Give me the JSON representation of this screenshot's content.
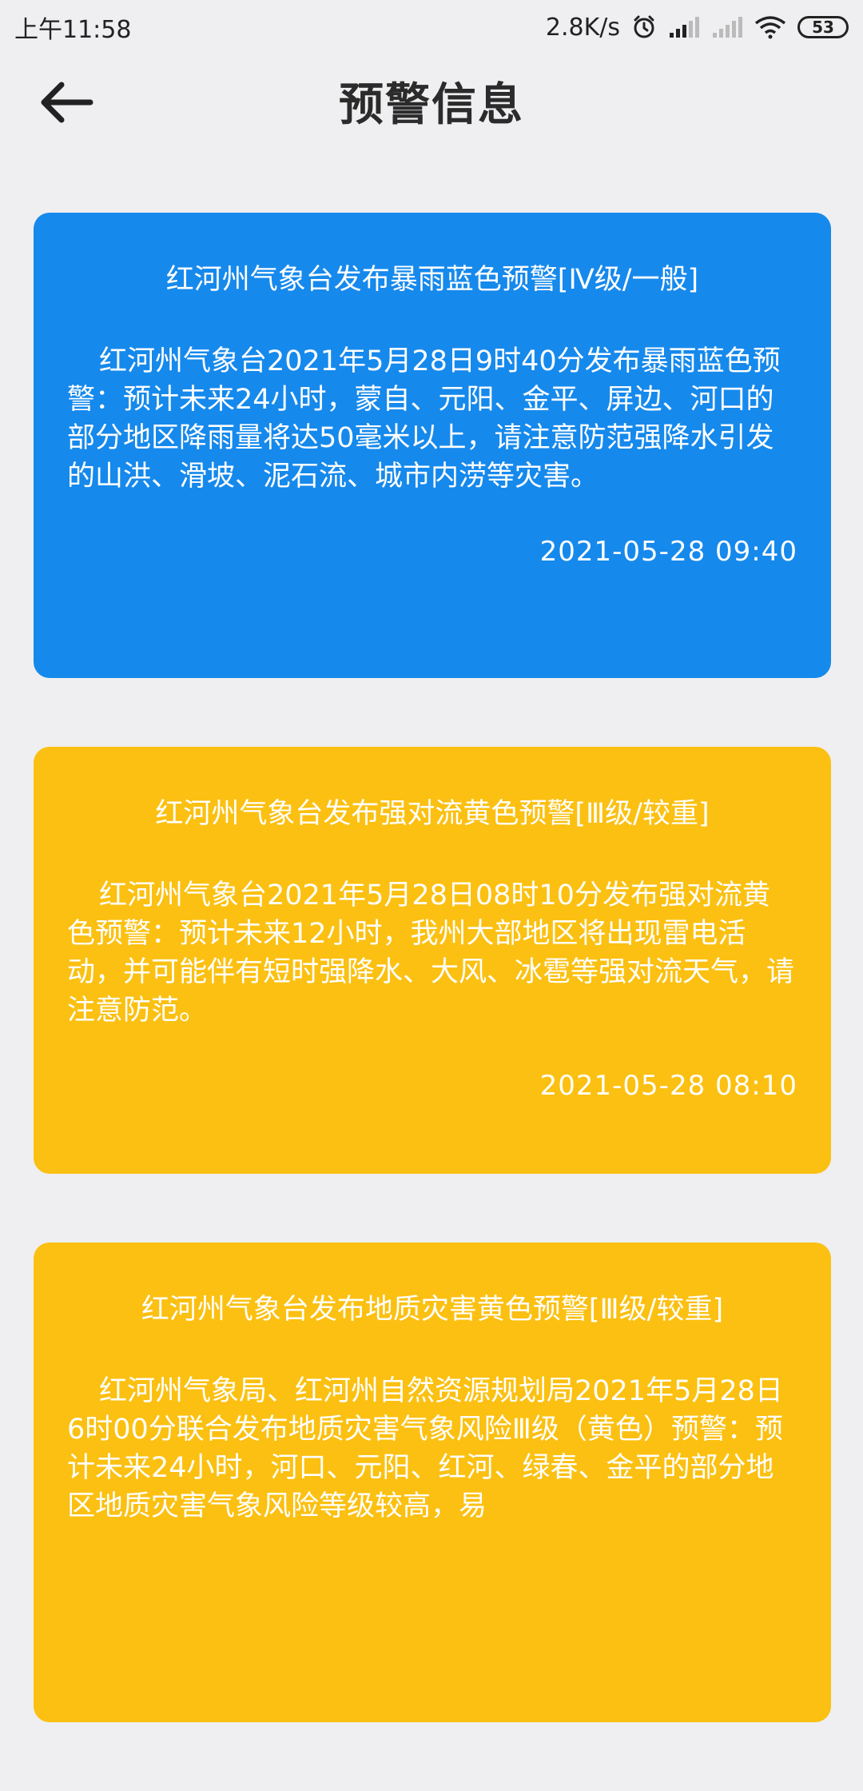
{
  "status_bar": {
    "time": "上午11:58",
    "net_speed": "2.8K/s",
    "battery": "53",
    "icons": [
      "alarm-icon",
      "signal-icon",
      "signal-weak-icon",
      "wifi-icon",
      "battery-icon"
    ]
  },
  "header": {
    "title": "预警信息",
    "back_icon": "arrow-left-icon"
  },
  "colors": {
    "blue": "#1689ec",
    "yellow": "#fbc011",
    "background": "#efeff1"
  },
  "alerts": [
    {
      "title": "红河州气象台发布暴雨蓝色预警[Ⅳ级/一般]",
      "body": "红河州气象台2021年5月28日9时40分发布暴雨蓝色预警：预计未来24小时，蒙自、元阳、金平、屏边、河口的部分地区降雨量将达50毫米以上，请注意防范强降水引发的山洪、滑坡、泥石流、城市内涝等灾害。",
      "time": "2021-05-28 09:40",
      "color": "blue"
    },
    {
      "title": "红河州气象台发布强对流黄色预警[Ⅲ级/较重]",
      "body": "红河州气象台2021年5月28日08时10分发布强对流黄色预警：预计未来12小时，我州大部地区将出现雷电活动，并可能伴有短时强降水、大风、冰雹等强对流天气，请注意防范。",
      "time": "2021-05-28 08:10",
      "color": "yellow"
    },
    {
      "title": "红河州气象台发布地质灾害黄色预警[Ⅲ级/较重]",
      "body": "红河州气象局、红河州自然资源规划局2021年5月28日6时00分联合发布地质灾害气象风险Ⅲ级（黄色）预警：预计未来24小时，河口、元阳、红河、绿春、金平的部分地区地质灾害气象风险等级较高，易",
      "color": "yellow"
    }
  ]
}
